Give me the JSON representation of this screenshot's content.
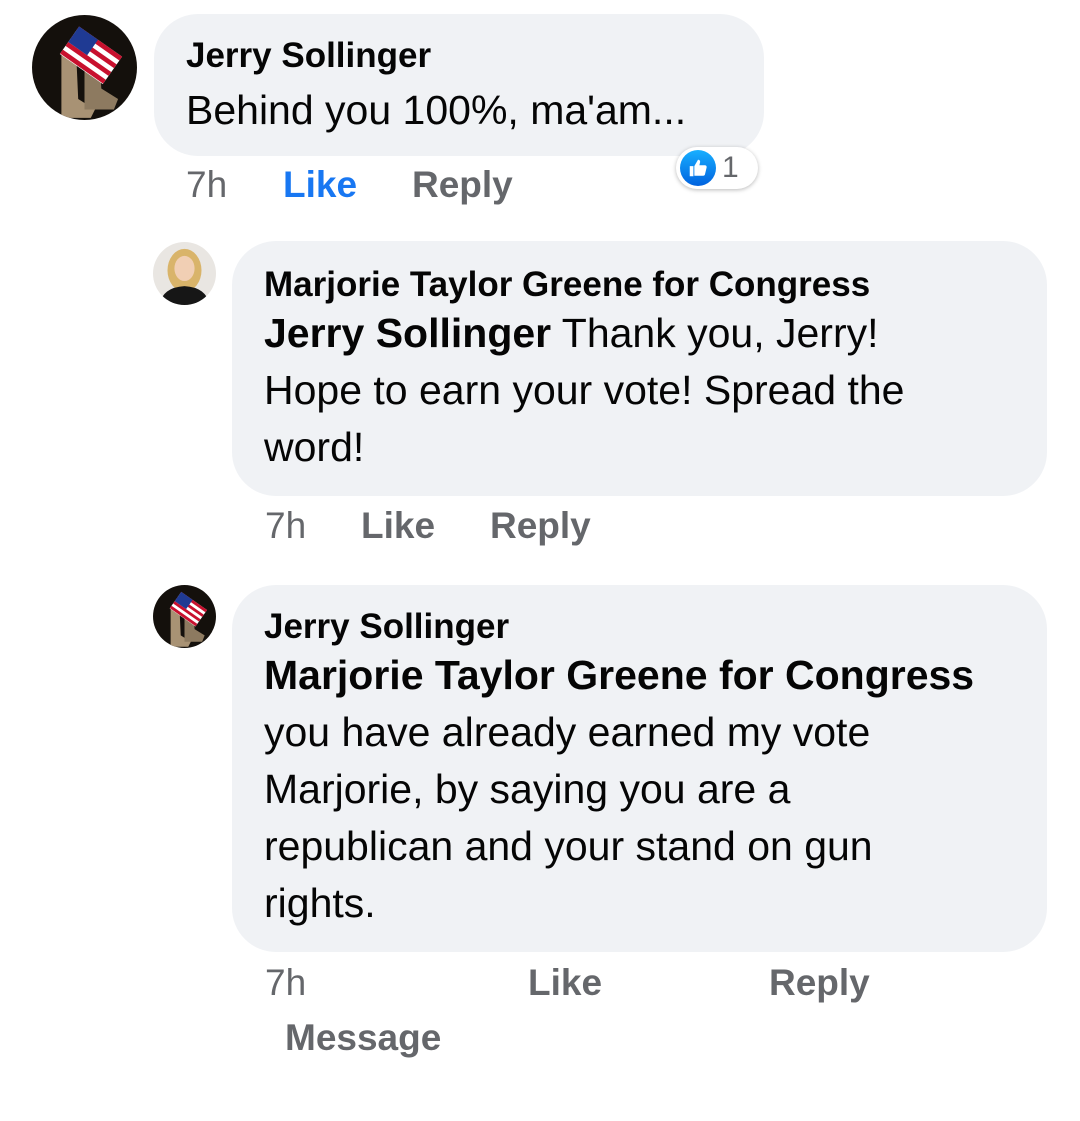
{
  "comments": [
    {
      "author": "Jerry Sollinger",
      "text": "Behind you 100%, ma'am...",
      "time": "7h",
      "like_label": "Like",
      "reply_label": "Reply",
      "liked": true,
      "reaction": {
        "icon": "thumbs-up-icon",
        "count": "1"
      }
    },
    {
      "author": "Marjorie Taylor Greene for Congress",
      "mention": "Jerry Sollinger",
      "lines": [
        " Thank you, Jerry!",
        "Hope to earn your vote! Spread the",
        "word!"
      ],
      "time": "7h",
      "like_label": "Like",
      "reply_label": "Reply"
    },
    {
      "author": "Jerry Sollinger",
      "mention": "Marjorie Taylor Greene for Congress",
      "lines": [
        "you have already earned my vote",
        "Marjorie, by saying you are a",
        "republican and your stand on gun",
        "rights."
      ],
      "time": "7h",
      "like_label": "Like",
      "reply_label": "Reply",
      "message_label": "Message"
    }
  ],
  "colors": {
    "bubble": "#f0f2f5",
    "action_text": "#65676b",
    "liked": "#1877f2"
  }
}
